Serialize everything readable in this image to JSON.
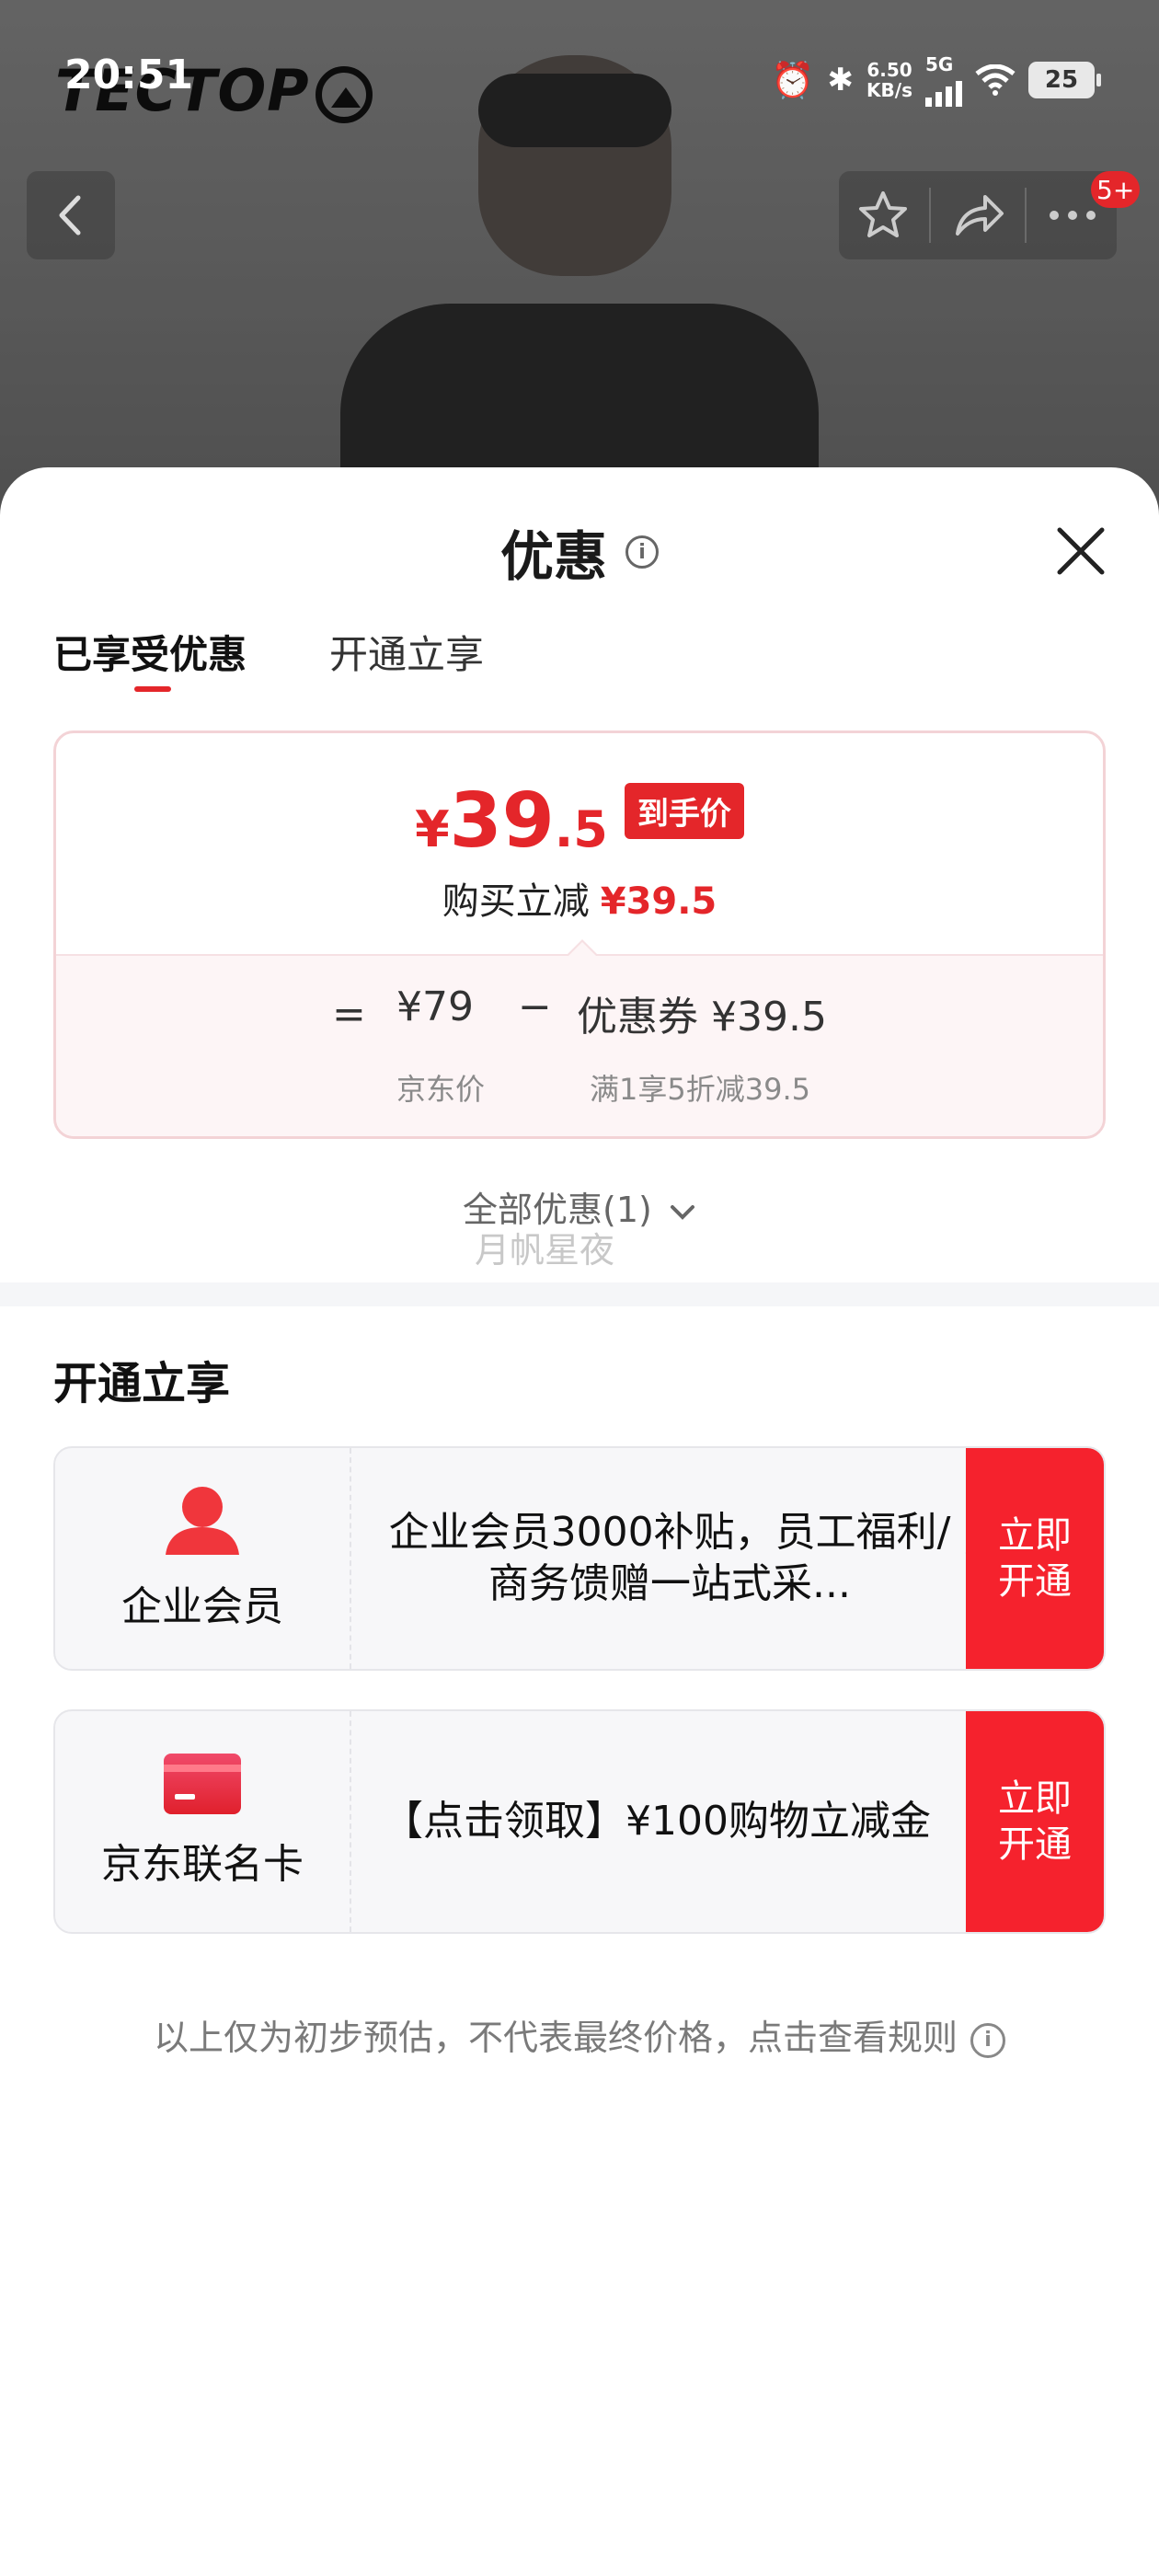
{
  "status_bar": {
    "time": "20:51",
    "net_speed": "6.50",
    "net_unit": "KB/s",
    "network": "5G",
    "battery": "25"
  },
  "background": {
    "brand_logo": "TECTOP",
    "notification_badge": "5+"
  },
  "sheet": {
    "title": "优惠",
    "tabs": [
      {
        "label": "已享受优惠",
        "active": true
      },
      {
        "label": "开通立享",
        "active": false
      }
    ],
    "price_card": {
      "currency": "¥",
      "price_int": "39",
      "price_dec": ".5",
      "price_tag": "到手价",
      "discount_label": "购买立减",
      "discount_value": "¥39.5",
      "formula_eq": "=",
      "jd_price": "¥79",
      "formula_minus": "−",
      "coupon_label": "优惠券 ¥39.5",
      "jd_price_note": "京东价",
      "coupon_note": "满1享5折减39.5"
    },
    "all_offers": "全部优惠(1)",
    "faint_text": "月帆星夜",
    "section_title": "开通立享",
    "promos": [
      {
        "name": "企业会员",
        "icon": "user-icon",
        "description": "企业会员3000补贴，员工福利/商务馈赠一站式采...",
        "button_line1": "立即",
        "button_line2": "开通"
      },
      {
        "name": "京东联名卡",
        "icon": "card-icon",
        "description": "【点击领取】¥100购物立减金",
        "button_line1": "立即",
        "button_line2": "开通"
      }
    ],
    "footnote": "以上仅为初步预估，不代表最终价格，点击查看规则"
  },
  "colors": {
    "accent": "#e4262a",
    "button": "#f5222d"
  }
}
